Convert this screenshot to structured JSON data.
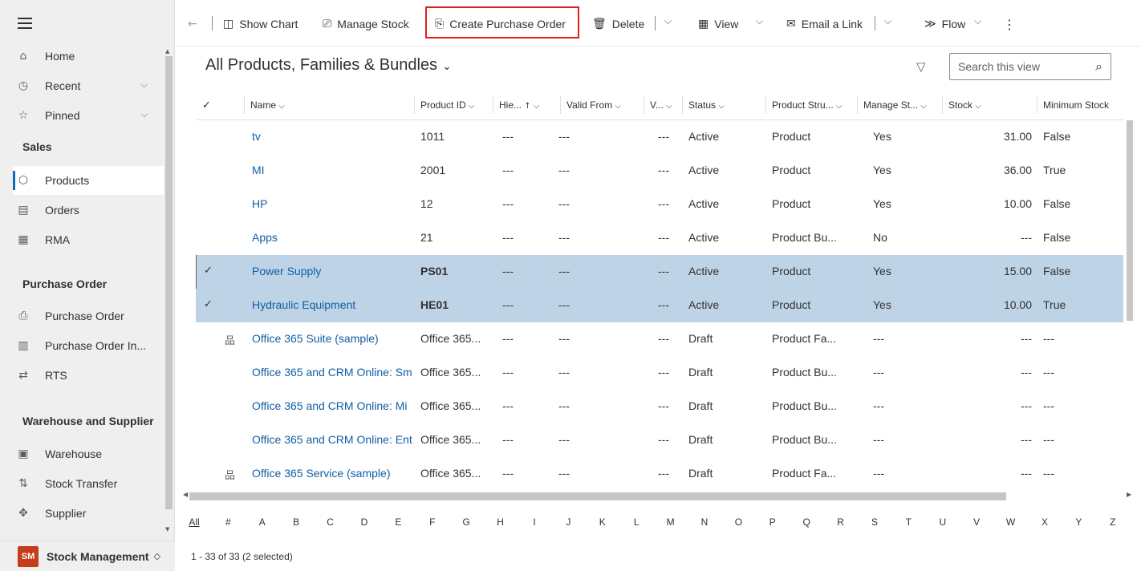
{
  "sidebar": {
    "items": [
      {
        "label": "Home",
        "icon": "home-icon",
        "glyph": "⌂"
      },
      {
        "label": "Recent",
        "icon": "clock-icon",
        "glyph": "◷",
        "has_chevron": true
      },
      {
        "label": "Pinned",
        "icon": "pin-icon",
        "glyph": "☆",
        "has_chevron": true
      }
    ],
    "groups": [
      {
        "title": "Sales",
        "items": [
          {
            "label": "Products",
            "icon": "product-icon",
            "glyph": "⬡",
            "active": true
          },
          {
            "label": "Orders",
            "icon": "document-icon",
            "glyph": "▤"
          },
          {
            "label": "RMA",
            "icon": "rma-icon",
            "glyph": "▦"
          }
        ]
      },
      {
        "title": "Purchase Order",
        "items": [
          {
            "label": "Purchase Order",
            "icon": "purchase-order-icon",
            "glyph": "⎙"
          },
          {
            "label": "Purchase Order In...",
            "icon": "invoice-icon",
            "glyph": "▥"
          },
          {
            "label": "RTS",
            "icon": "return-icon",
            "glyph": "⇄"
          }
        ]
      },
      {
        "title": "Warehouse and Supplier",
        "items": [
          {
            "label": "Warehouse",
            "icon": "warehouse-icon",
            "glyph": "▣"
          },
          {
            "label": "Stock Transfer",
            "icon": "transfer-icon",
            "glyph": "⇅"
          },
          {
            "label": "Supplier",
            "icon": "supplier-icon",
            "glyph": "✥"
          }
        ]
      }
    ],
    "area_badge": "SM",
    "area_name": "Stock Management",
    "area_switch_glyph": "◇"
  },
  "commandbar": {
    "back_glyph": "←",
    "show_chart": "Show Chart",
    "manage_stock": "Manage Stock",
    "create_purchase_order": "Create Purchase Order",
    "delete": "Delete",
    "view": "View",
    "email_link": "Email a Link",
    "flow": "Flow",
    "more_glyph": "⋮",
    "highlight_color": "#e02020"
  },
  "view": {
    "title": "All Products, Families & Bundles",
    "search_placeholder": "Search this view"
  },
  "grid": {
    "columns": [
      "Name",
      "Product ID",
      "Hie...",
      "Valid From",
      "V...",
      "Status",
      "Product Stru...",
      "Manage St...",
      "Stock",
      "Minimum Stock"
    ],
    "rows": [
      {
        "hier": "",
        "name": "tv",
        "id": "1011",
        "hie": "---",
        "valid": "---",
        "v": "---",
        "status": "Active",
        "struct": "Product",
        "manage": "Yes",
        "stock": "31.00",
        "min": "False",
        "selected": false
      },
      {
        "hier": "",
        "name": "MI",
        "id": "2001",
        "hie": "---",
        "valid": "---",
        "v": "---",
        "status": "Active",
        "struct": "Product",
        "manage": "Yes",
        "stock": "36.00",
        "min": "True",
        "selected": false
      },
      {
        "hier": "",
        "name": "HP",
        "id": "12",
        "hie": "---",
        "valid": "---",
        "v": "---",
        "status": "Active",
        "struct": "Product",
        "manage": "Yes",
        "stock": "10.00",
        "min": "False",
        "selected": false
      },
      {
        "hier": "",
        "name": "Apps",
        "id": "21",
        "hie": "---",
        "valid": "---",
        "v": "---",
        "status": "Active",
        "struct": "Product Bu...",
        "manage": "No",
        "stock": "---",
        "min": "False",
        "selected": false
      },
      {
        "hier": "",
        "name": "Power Supply",
        "id": "PS01",
        "hie": "---",
        "valid": "---",
        "v": "---",
        "status": "Active",
        "struct": "Product",
        "manage": "Yes",
        "stock": "15.00",
        "min": "False",
        "selected": true
      },
      {
        "hier": "",
        "name": "Hydraulic Equipment",
        "id": "HE01",
        "hie": "---",
        "valid": "---",
        "v": "---",
        "status": "Active",
        "struct": "Product",
        "manage": "Yes",
        "stock": "10.00",
        "min": "True",
        "selected": true
      },
      {
        "hier": "品",
        "name": "Office 365 Suite (sample)",
        "id": "Office 365...",
        "hie": "---",
        "valid": "---",
        "v": "---",
        "status": "Draft",
        "struct": "Product Fa...",
        "manage": "---",
        "stock": "---",
        "min": "---",
        "selected": false
      },
      {
        "hier": "",
        "name": "Office 365 and CRM Online: Sm",
        "id": "Office 365...",
        "hie": "---",
        "valid": "---",
        "v": "---",
        "status": "Draft",
        "struct": "Product Bu...",
        "manage": "---",
        "stock": "---",
        "min": "---",
        "selected": false
      },
      {
        "hier": "",
        "name": "Office 365 and CRM Online: Mi",
        "id": "Office 365...",
        "hie": "---",
        "valid": "---",
        "v": "---",
        "status": "Draft",
        "struct": "Product Bu...",
        "manage": "---",
        "stock": "---",
        "min": "---",
        "selected": false
      },
      {
        "hier": "",
        "name": "Office 365 and CRM Online: Ent",
        "id": "Office 365...",
        "hie": "---",
        "valid": "---",
        "v": "---",
        "status": "Draft",
        "struct": "Product Bu...",
        "manage": "---",
        "stock": "---",
        "min": "---",
        "selected": false
      },
      {
        "hier": "品",
        "name": "Office 365 Service (sample)",
        "id": "Office 365...",
        "hie": "---",
        "valid": "---",
        "v": "---",
        "status": "Draft",
        "struct": "Product Fa...",
        "manage": "---",
        "stock": "---",
        "min": "---",
        "selected": false
      }
    ],
    "selected_color": "#bfd3e6",
    "link_color": "#115ea3"
  },
  "jumpbar": [
    "All",
    "#",
    "A",
    "B",
    "C",
    "D",
    "E",
    "F",
    "G",
    "H",
    "I",
    "J",
    "K",
    "L",
    "M",
    "N",
    "O",
    "P",
    "Q",
    "R",
    "S",
    "T",
    "U",
    "V",
    "W",
    "X",
    "Y",
    "Z"
  ],
  "status": {
    "text": "1 - 33 of 33 (2 selected)"
  }
}
